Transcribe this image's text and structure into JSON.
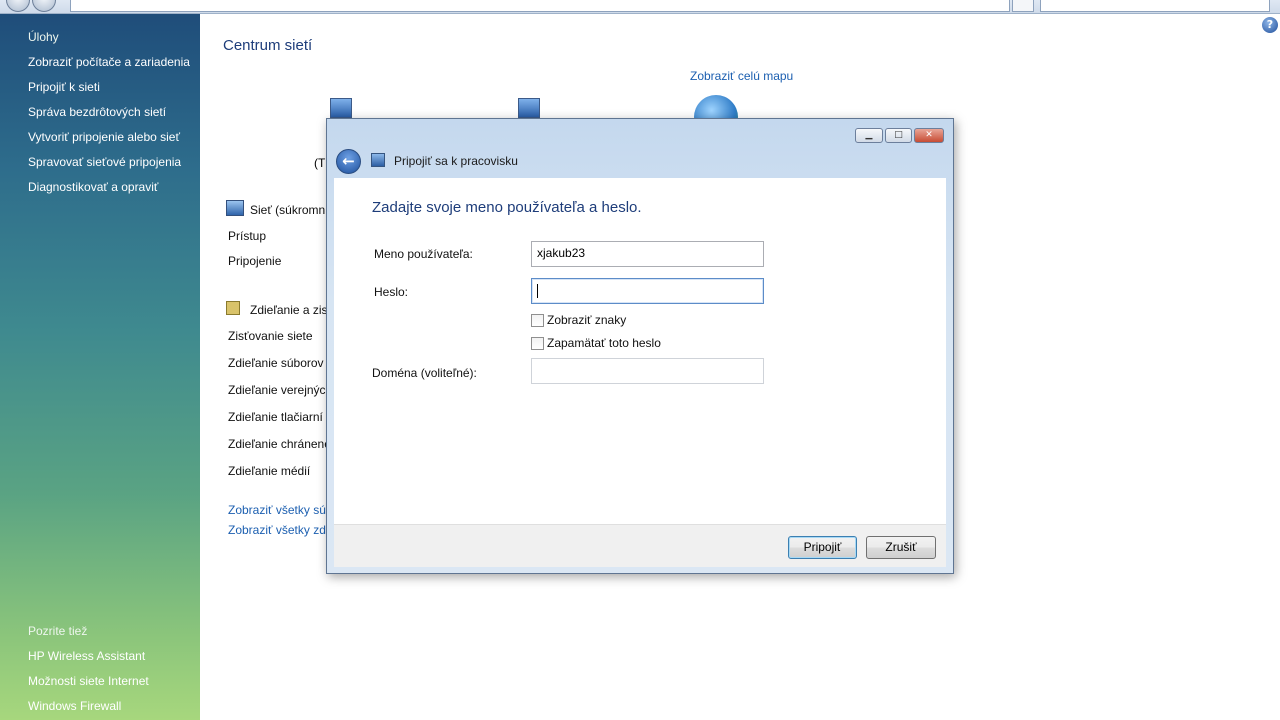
{
  "sidebar": {
    "tasks_header": "Úlohy",
    "items": [
      {
        "label": "Zobraziť počítače a zariadenia"
      },
      {
        "label": "Pripojiť k sieti"
      },
      {
        "label": "Správa bezdrôtových sietí"
      },
      {
        "label": "Vytvoriť pripojenie alebo sieť"
      },
      {
        "label": "Spravovať sieťové pripojenia"
      },
      {
        "label": "Diagnostikovať a opraviť"
      }
    ],
    "see_also_header": "Pozrite tiež",
    "see_also": [
      {
        "label": "HP Wireless Assistant"
      },
      {
        "label": "Možnosti siete Internet"
      },
      {
        "label": "Windows Firewall"
      }
    ]
  },
  "main": {
    "title": "Centrum sietí",
    "map_link": "Zobraziť celú mapu",
    "paren_text": "(T",
    "network_label": "Sieť (súkromn",
    "network_rows": [
      "Prístup",
      "Pripojenie"
    ],
    "sharing_header": "Zdieľanie a zis",
    "sharing_rows": [
      "Zisťovanie siete",
      "Zdieľanie súborov",
      "Zdieľanie verejných",
      "Zdieľanie tlačiarní",
      "Zdieľanie chránene",
      "Zdieľanie médií"
    ],
    "links": [
      "Zobraziť všetky súb",
      "Zobraziť všetky zdi"
    ]
  },
  "dialog": {
    "title": "Pripojiť sa k pracovisku",
    "instruction": "Zadajte svoje meno používateľa a heslo.",
    "username_label": "Meno používateľa:",
    "username_value": "xjakub23",
    "password_label": "Heslo:",
    "password_value": "",
    "show_chars_label": "Zobraziť znaky",
    "remember_label": "Zapamätať toto heslo",
    "domain_label": "Doména (voliteľné):",
    "domain_value": "",
    "connect_button": "Pripojiť",
    "cancel_button": "Zrušiť"
  }
}
